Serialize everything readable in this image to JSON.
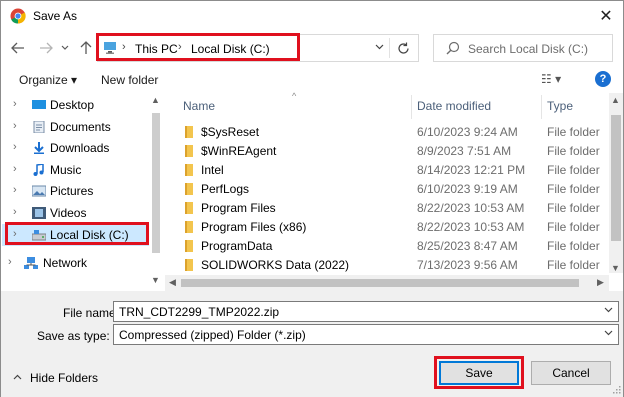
{
  "window": {
    "title": "Save As",
    "close_symbol": "✕"
  },
  "address": {
    "crumbs": [
      "This PC",
      "Local Disk (C:)"
    ],
    "search_placeholder": "Search Local Disk (C:)"
  },
  "toolbar": {
    "organize_label": "Organize ▾",
    "new_folder_label": "New folder",
    "view_label": "☷ ▾",
    "help_label": "?"
  },
  "nav": {
    "items": [
      {
        "label": "Desktop",
        "icon": "desktop-icon"
      },
      {
        "label": "Documents",
        "icon": "documents-icon"
      },
      {
        "label": "Downloads",
        "icon": "downloads-icon"
      },
      {
        "label": "Music",
        "icon": "music-icon"
      },
      {
        "label": "Pictures",
        "icon": "pictures-icon"
      },
      {
        "label": "Videos",
        "icon": "videos-icon"
      },
      {
        "label": "Local Disk (C:)",
        "icon": "drive-icon",
        "selected": true
      },
      {
        "label": "Network",
        "icon": "network-icon"
      }
    ]
  },
  "files": {
    "columns": {
      "name": "Name",
      "date": "Date modified",
      "type": "Type"
    },
    "rows": [
      {
        "name": "$SysReset",
        "date": "6/10/2023 9:24 AM",
        "type": "File folder"
      },
      {
        "name": "$WinREAgent",
        "date": "8/9/2023 7:51 AM",
        "type": "File folder"
      },
      {
        "name": "Intel",
        "date": "8/14/2023 12:21 PM",
        "type": "File folder"
      },
      {
        "name": "PerfLogs",
        "date": "6/10/2023 9:19 AM",
        "type": "File folder"
      },
      {
        "name": "Program Files",
        "date": "8/22/2023 10:53 AM",
        "type": "File folder"
      },
      {
        "name": "Program Files (x86)",
        "date": "8/22/2023 10:53 AM",
        "type": "File folder"
      },
      {
        "name": "ProgramData",
        "date": "8/25/2023 8:47 AM",
        "type": "File folder"
      },
      {
        "name": "SOLIDWORKS Data (2022)",
        "date": "7/13/2023 9:56 AM",
        "type": "File folder"
      }
    ]
  },
  "save_form": {
    "file_name_label": "File name:",
    "file_name_value": "TRN_CDT2299_TMP2022.zip",
    "save_type_label": "Save as type:",
    "save_type_value": "Compressed (zipped) Folder (*.zip)"
  },
  "footer": {
    "hide_folders_label": "Hide Folders",
    "save_label": "Save",
    "cancel_label": "Cancel"
  },
  "colors": {
    "highlight_red": "#e0101e",
    "selection_blue": "#cce8ff",
    "accent_blue": "#0078d7"
  }
}
